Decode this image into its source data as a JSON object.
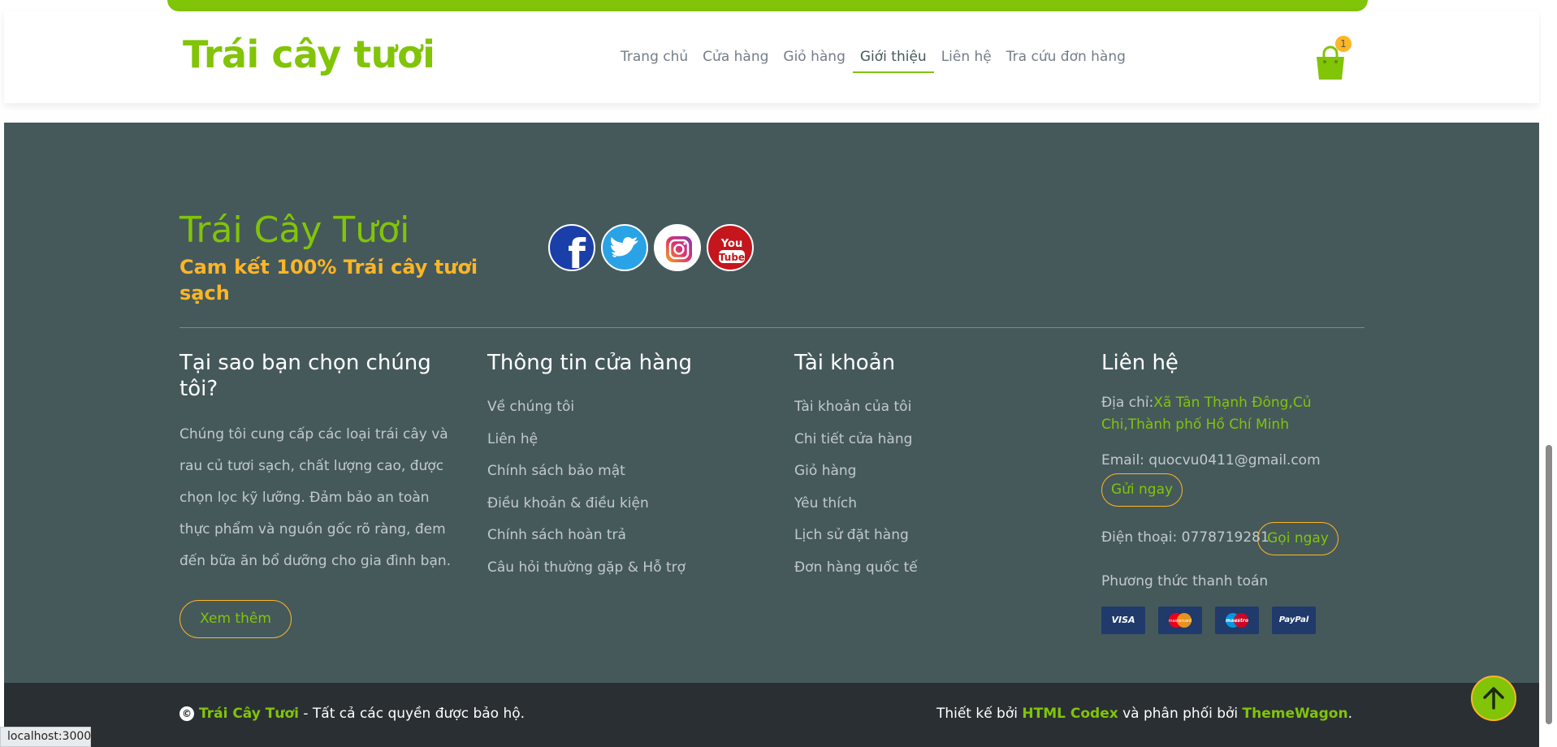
{
  "header": {
    "brand": "Trái cây tươi",
    "nav": [
      "Trang chủ",
      "Cửa hàng",
      "Giỏ hàng",
      "Giới thiệu",
      "Liên hệ",
      "Tra cứu đơn hàng"
    ],
    "active_nav": "Giới thiệu",
    "cart_count": "1"
  },
  "footer": {
    "brand": "Trái Cây Tươi",
    "slogan": "Cam kết 100% Trái cây tươi sạch",
    "social": [
      "facebook-icon",
      "twitter-icon",
      "instagram-icon",
      "youtube-icon"
    ],
    "why": {
      "title": "Tại sao bạn chọn chúng tôi?",
      "text": "Chúng tôi cung cấp các loại trái cây và rau củ tươi sạch, chất lượng cao, được chọn lọc kỹ lưỡng. Đảm bảo an toàn thực phẩm và nguồn gốc rõ ràng, đem đến bữa ăn bổ dưỡng cho gia đình bạn.",
      "button": "Xem thêm"
    },
    "store": {
      "title": "Thông tin cửa hàng",
      "links": [
        "Về chúng tôi",
        "Liên hệ",
        "Chính sách bảo mật",
        "Điều khoản & điều kiện",
        "Chính sách hoàn trả",
        "Câu hỏi thường gặp & Hỗ trợ"
      ]
    },
    "account": {
      "title": "Tài khoản",
      "links": [
        "Tài khoản của tôi",
        "Chi tiết cửa hàng",
        "Giỏ hàng",
        "Yêu thích",
        "Lịch sử đặt hàng",
        "Đơn hàng quốc tế"
      ]
    },
    "contact": {
      "title": "Liên hệ",
      "address_label": "Địa chỉ:",
      "address": "Xã Tân Thạnh Đông,Củ Chi,Thành phố Hồ Chí Minh",
      "email": "Email: quocvu0411@gmail.com",
      "email_button": "Gửi ngay",
      "phone": "Điện thoại: 0778719281",
      "phone_button": "Gọi ngay",
      "payment_label": "Phương thức thanh toán",
      "payments": [
        "VISA",
        "mastercard",
        "maestro",
        "PayPal"
      ]
    }
  },
  "bottom": {
    "copy_brand": "Trái Cây Tươi",
    "copy_text": " - Tất cả các quyền được bảo hộ.",
    "credit_1": "Thiết kế bởi ",
    "credit_html": "HTML Codex",
    "credit_2": " và phân phối bởi ",
    "credit_tw": "ThemeWagon",
    "credit_3": "."
  },
  "status_url": "localhost:3000",
  "colors": {
    "primary": "#81c408",
    "secondary": "#ffb524",
    "footer_bg": "#45595b",
    "bottom_bg": "#2a2f33"
  }
}
